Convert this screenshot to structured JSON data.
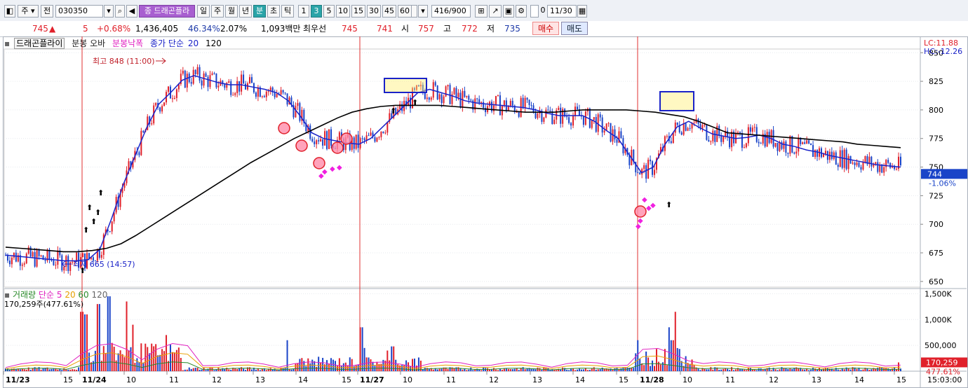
{
  "toolbar": {
    "market_label": "주",
    "all_label": "전",
    "code_value": "030350",
    "stock_name": "드래곤플라",
    "periods": [
      "일",
      "주",
      "월",
      "년",
      "분",
      "초",
      "틱"
    ],
    "selected_period": "분",
    "intervals": [
      "1",
      "3",
      "5",
      "10",
      "15",
      "30",
      "45",
      "60"
    ],
    "selected_interval": "3",
    "interval_value": "3",
    "count_value": "416",
    "count_total": "/900",
    "date_checkbox_label": "0",
    "date_value": "11/30"
  },
  "quote": {
    "price": "745",
    "arrow": "▲",
    "change": "5",
    "change_pct": "+0.68%",
    "volume": "1,436,405",
    "volume_ratio": "46.34%",
    "turnover_pct": "2.07%",
    "amount": "1,093백만",
    "best_ask_label": "최우선",
    "best_ask": "745",
    "best_bid": "741",
    "open_label": "시",
    "open": "757",
    "high_label": "고",
    "high": "772",
    "low_label": "저",
    "low": "735",
    "buy_label": "매수",
    "sell_label": "매도"
  },
  "legend": {
    "name": "드래곤플라이",
    "candle": "분봉 오바",
    "candle_range": "분봉낙폭",
    "ma_label": "종가 단순",
    "ma_periods": [
      "20",
      "120"
    ]
  },
  "volume_legend": {
    "label": "거래량",
    "ma_label": "단순",
    "periods": [
      "5",
      "20",
      "60",
      "120"
    ],
    "current": "170,259주(477.61%)"
  },
  "annotations": {
    "high": "최고 848 (11:00)",
    "low": "최저 665 (14:57)",
    "lc": "LC:11.88",
    "hc": "HC:-12.26",
    "current_price": "744",
    "current_pct": "-1.06%",
    "current_volume": "170,259",
    "current_volume_pct": "477.61%",
    "time": "15:03:00"
  },
  "chart_data": {
    "type": "line",
    "price_axis": {
      "ticks": [
        650,
        675,
        700,
        725,
        750,
        775,
        800,
        825,
        850
      ],
      "range": [
        645,
        852
      ]
    },
    "volume_axis": {
      "ticks": [
        "500,000",
        "1,000K",
        "1,500K"
      ],
      "values": [
        500000,
        1000000,
        1500000
      ],
      "max": 1600000
    },
    "x_labels": [
      "11/23",
      "15",
      "11/24",
      "10",
      "11",
      "12",
      "13",
      "14",
      "15",
      "11/27",
      "10",
      "11",
      "12",
      "13",
      "14",
      "15",
      "11/28",
      "10",
      "11",
      "12",
      "13",
      "14",
      "15"
    ],
    "day_labels": [
      "11/23",
      "11/24",
      "11/27",
      "11/28"
    ],
    "series": [
      {
        "name": "20",
        "color": "#1a22c8",
        "values": [
          673,
          672,
          671,
          670,
          669,
          668,
          668,
          669,
          678,
          705,
          735,
          760,
          785,
          805,
          815,
          826,
          830,
          827,
          824,
          822,
          822,
          820,
          818,
          815,
          808,
          795,
          780,
          775,
          773,
          771,
          770,
          775,
          785,
          795,
          805,
          815,
          818,
          815,
          812,
          808,
          806,
          805,
          804,
          803,
          802,
          800,
          797,
          795,
          795,
          795,
          790,
          782,
          775,
          760,
          745,
          750,
          770,
          785,
          790,
          784,
          779,
          777,
          775,
          776,
          778,
          775,
          770,
          768,
          765,
          763,
          760,
          758,
          756,
          754,
          752,
          751,
          750
        ]
      },
      {
        "name": "120",
        "color": "#000000",
        "values": [
          680,
          679,
          678,
          677,
          676,
          676,
          677,
          679,
          683,
          690,
          698,
          706,
          714,
          722,
          730,
          738,
          746,
          754,
          761,
          768,
          775,
          781,
          787,
          793,
          798,
          801,
          803,
          804,
          804,
          804,
          804,
          803,
          802,
          801,
          800,
          799,
          798,
          798,
          798,
          799,
          800,
          800,
          800,
          800,
          799,
          798,
          796,
          794,
          790,
          785,
          780,
          779,
          778,
          777,
          776,
          775,
          774,
          773,
          772,
          770,
          769,
          768,
          767
        ]
      }
    ],
    "volume": {
      "label": "거래량",
      "max_visible": 1500000
    }
  }
}
